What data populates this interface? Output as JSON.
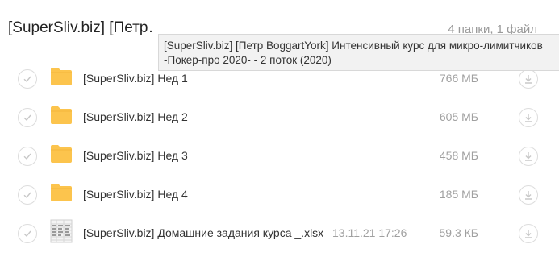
{
  "header": {
    "title": "[SuperSliv.biz] [Петр BoggartYork] Интенсивный курс для микро-лимитчиков -Покер-про 2020- - 2 поток (2020)",
    "title_visible": "[SuperSliv.biz] [Петр…",
    "count": "4 папки, 1 файл"
  },
  "tooltip": {
    "line1": "[SuperSliv.biz] [Петр BoggartYork] Интенсивный курс для микро-лимитчиков",
    "line2": "-Покер-про 2020- - 2 поток (2020)"
  },
  "colors": {
    "folder": "#fcc44d",
    "folder_dark": "#f4b63a",
    "muted_text": "#a0a0a0",
    "circle_border": "#dcdcdc"
  },
  "items": [
    {
      "type": "folder",
      "icon": "folder-icon",
      "name": "[SuperSliv.biz] Нед 1",
      "date": "",
      "size": "766 МБ"
    },
    {
      "type": "folder",
      "icon": "folder-icon",
      "name": "[SuperSliv.biz] Нед 2",
      "date": "",
      "size": "605 МБ"
    },
    {
      "type": "folder",
      "icon": "folder-icon",
      "name": "[SuperSliv.biz] Нед 3",
      "date": "",
      "size": "458 МБ"
    },
    {
      "type": "folder",
      "icon": "folder-icon",
      "name": "[SuperSliv.biz] Нед 4",
      "date": "",
      "size": "185 МБ"
    },
    {
      "type": "file",
      "icon": "spreadsheet-file-icon",
      "name": "[SuperSliv.biz] Домашние задания курса _.xlsx",
      "date": "13.11.21 17:26",
      "size": "59.3 КБ"
    }
  ]
}
